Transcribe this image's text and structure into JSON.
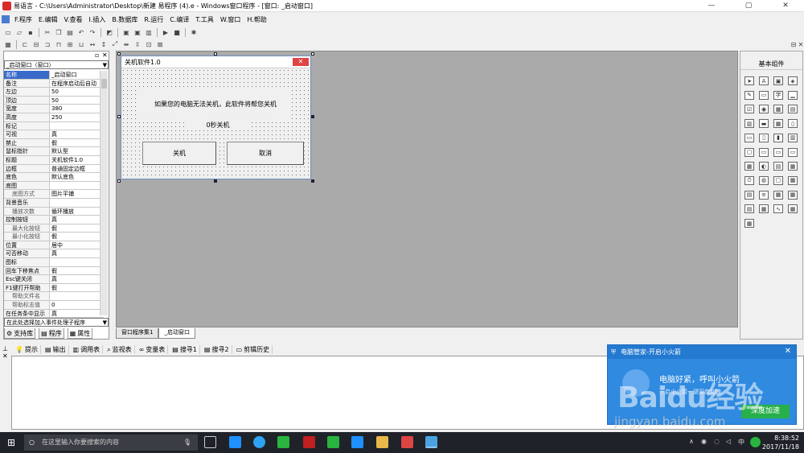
{
  "window": {
    "title": "易语言 - C:\\Users\\Administrator\\Desktop\\新建 易程序 (4).e - Windows窗口程序 - [窗口: _启动窗口]",
    "min": "—",
    "max": "▢",
    "close": "✕"
  },
  "menu": [
    "F.程序",
    "E.编辑",
    "V.查看",
    "I.插入",
    "B.数据库",
    "R.运行",
    "C.编译",
    "T.工具",
    "W.窗口",
    "H.帮助"
  ],
  "left": {
    "combo": "_启动窗口（窗口）",
    "props": [
      {
        "name": "名称",
        "value": "_启动窗口",
        "selected": true
      },
      {
        "name": "备注",
        "value": "在程序启动后自动"
      },
      {
        "name": "左边",
        "value": "50"
      },
      {
        "name": "顶边",
        "value": "50"
      },
      {
        "name": "宽度",
        "value": "380"
      },
      {
        "name": "高度",
        "value": "250"
      },
      {
        "name": "标记",
        "value": ""
      },
      {
        "name": "可视",
        "value": "真"
      },
      {
        "name": "禁止",
        "value": "假"
      },
      {
        "name": "鼠标指针",
        "value": "默认型"
      },
      {
        "name": "标题",
        "value": "关机软件1.0"
      },
      {
        "name": "边框",
        "value": "普通固定边框"
      },
      {
        "name": "底色",
        "value": "默认底色"
      },
      {
        "name": "底图",
        "value": ""
      },
      {
        "name": "底图方式",
        "value": "图片平铺",
        "sub": true
      },
      {
        "name": "背景音乐",
        "value": ""
      },
      {
        "name": "播放次数",
        "value": "循环播放",
        "sub": true
      },
      {
        "name": "控制按钮",
        "value": "真"
      },
      {
        "name": "最大化按钮",
        "value": "假",
        "sub": true
      },
      {
        "name": "最小化按钮",
        "value": "假",
        "sub": true
      },
      {
        "name": "位置",
        "value": "居中"
      },
      {
        "name": "可否移动",
        "value": "真"
      },
      {
        "name": "图标",
        "value": ""
      },
      {
        "name": "回车下移焦点",
        "value": "假"
      },
      {
        "name": "Esc键关闭",
        "value": "真"
      },
      {
        "name": "F1键打开帮助",
        "value": "假"
      },
      {
        "name": "帮助文件名",
        "value": "",
        "sub": true
      },
      {
        "name": "帮助标志值",
        "value": "0",
        "sub": true
      },
      {
        "name": "在任务条中显示",
        "value": "真"
      }
    ],
    "event_combo": "在此处选择加入事件处理子程序",
    "tabs": [
      "支持库",
      "程序",
      "属性"
    ]
  },
  "form": {
    "title": "关机软件1.0",
    "close": "✕",
    "label1": "如果您的电脑无法关机，此软件将帮您关机",
    "label2": "0秒关机",
    "btn_shutdown": "关机",
    "btn_cancel": "取消"
  },
  "design_tabs": [
    "窗口程序集1",
    "_启动窗口"
  ],
  "right": {
    "title": "基本组件"
  },
  "bottom_tabs": [
    "提示",
    "输出",
    "调用表",
    "监视表",
    "变量表",
    "搜寻1",
    "搜寻2",
    "剪辑历史"
  ],
  "popup": {
    "title": "电脑管家-开启小火箭",
    "main": "电脑好紧，呼叫小火箭",
    "sub": "开启小火箭一键深度加速",
    "button": "深度加速",
    "close": "✕"
  },
  "watermark": {
    "logo": "Baidu经验",
    "url": "jingyan.baidu.com"
  },
  "taskbar": {
    "search": "在这里输入你要搜索的内容",
    "time": "8:38:52",
    "date": "2017/11/18"
  },
  "colors": {
    "selected": "#3a6ac9",
    "design_bg": "#aaaaaa",
    "popup": "#2f8ae0",
    "taskbar": "#1f2229"
  }
}
